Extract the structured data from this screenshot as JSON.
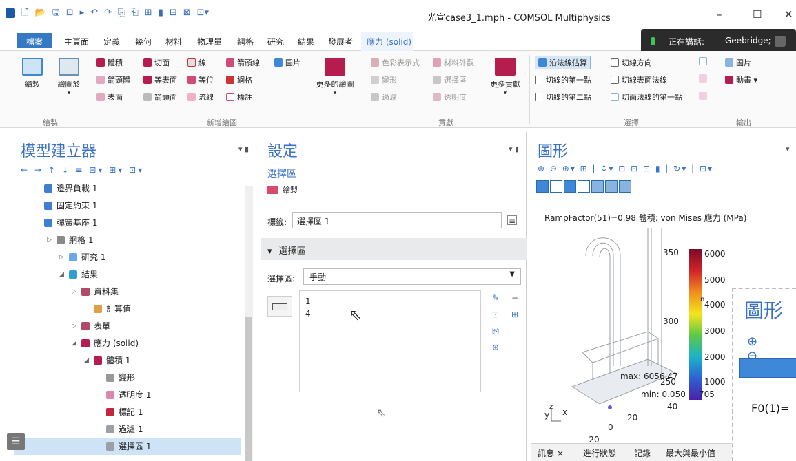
{
  "titlebar": {
    "title": "光宣case3_1.mph - COMSOL Multiphysics",
    "minimize": "–",
    "maximize": "☐",
    "close": "✕"
  },
  "tabs": [
    "檔案",
    "主頁面",
    "定義",
    "幾何",
    "材料",
    "物理量",
    "網格",
    "研究",
    "結果",
    "發展者",
    "應力 (solid)"
  ],
  "speaking": {
    "text": "正在講話:",
    "name": "Geebridge;"
  },
  "ribbon": {
    "draw": {
      "plot": "繪製",
      "plot_in": "繪圖於",
      "group": "繪製"
    },
    "add_plot": {
      "items": [
        "體積",
        "切面",
        "線",
        "箭頭線",
        "圖片",
        "箭頭體",
        "等表面",
        "等位",
        "網格",
        "表面",
        "箭頭面",
        "流線",
        "標註"
      ],
      "more": "更多的繪圖",
      "group": "新增繪圖"
    },
    "contrib": {
      "items": [
        "色彩表示式",
        "材料外觀",
        "變形",
        "選擇區",
        "過濾",
        "透明度"
      ],
      "more": "更多貢獻",
      "group": "貢獻"
    },
    "select": {
      "items": [
        "沿法線估算",
        "切線方向",
        "切線的第一點",
        "切線表面法線",
        "切線的第二點",
        "切面法線的第一點"
      ],
      "group": "選擇"
    },
    "output": {
      "image": "圖片",
      "animation": "動畫 ▾",
      "group": "輸出"
    }
  },
  "builder": {
    "title": "模型建立器",
    "toolbar": "← → ↑ ↓ ≡ ⊟▾ ⊞▾ ⊡▾",
    "items": [
      {
        "label": "邊界負載 1",
        "indent": 0,
        "color": "#3f7fd0"
      },
      {
        "label": "固定約束 1",
        "indent": 0,
        "color": "#3f7fd0"
      },
      {
        "label": "彈簧基座 1",
        "indent": 0,
        "color": "#3f7fd0"
      },
      {
        "label": "網格 1",
        "indent": 1,
        "color": "#8a8a8a",
        "arrow": "▷"
      },
      {
        "label": "研究 1",
        "indent": 2,
        "color": "#6aa8e8",
        "arrow": "▷"
      },
      {
        "label": "結果",
        "indent": 2,
        "color": "#2f9fd6",
        "arrow": "◢"
      },
      {
        "label": "資料集",
        "indent": 3,
        "color": "#b04a6a",
        "arrow": "▷"
      },
      {
        "label": "計算值",
        "indent": 4,
        "color": "#e0a04a"
      },
      {
        "label": "表單",
        "indent": 3,
        "color": "#b04a6a",
        "arrow": "▷"
      },
      {
        "label": "應力 (solid)",
        "indent": 3,
        "color": "#b51d4f",
        "arrow": "◢"
      },
      {
        "label": "體積 1",
        "indent": 4,
        "color": "#b51d4f",
        "arrow": "◢"
      },
      {
        "label": "變形",
        "indent": 5,
        "color": "#999999"
      },
      {
        "label": "透明度 1",
        "indent": 5,
        "color": "#d989b0"
      },
      {
        "label": "標記 1",
        "indent": 5,
        "color": "#c3253a"
      },
      {
        "label": "過濾 1",
        "indent": 5,
        "color": "#9aa0a6"
      },
      {
        "label": "選擇區 1",
        "indent": 5,
        "color": "#9aa0a6",
        "selected": true
      }
    ]
  },
  "settings": {
    "title": "設定",
    "subtitle": "選擇區",
    "plot_action": "繪製",
    "label_field": "標籤:",
    "label_value": "選擇區 1",
    "section": "選擇區",
    "selection_label": "選擇區:",
    "selection_value": "手動",
    "list": [
      "1",
      "4"
    ]
  },
  "graphics": {
    "title": "圖形",
    "toolbar": "⊕ ⊖ ⊕▾ ⊞ | ↕▾ ⊡ ⊡ ⊡ ▮ | ↻▾ | ⊡▾",
    "plot_title": "RampFactor(51)=0.98  體積: von Mises 應力 (MPa)",
    "colorbar_ticks": [
      "6000",
      "5000",
      "4000",
      "3000",
      "2000",
      "1000"
    ],
    "max_label": "max: 6056.47",
    "min_label": "min: 0.050",
    "min_label_tail": "705",
    "axis_values": [
      "350",
      "300",
      "250",
      "40",
      "20",
      "0",
      "-20"
    ],
    "axis_x": "x",
    "axis_y": "y",
    "axis_z": "z",
    "bottom_tabs": [
      "訊息 ×",
      "進行狀態",
      "記錄",
      "最大與最小值"
    ],
    "superscript": "n"
  },
  "zoom": {
    "title": "圖形",
    "icons": "⊕ ⊖",
    "label": "F0(1)="
  }
}
